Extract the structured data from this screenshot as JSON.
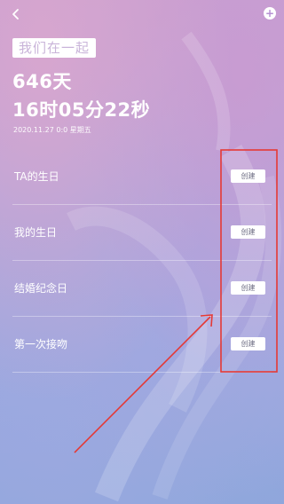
{
  "header": {
    "back_icon": "chevron-left-icon",
    "add_icon": "plus-circle-icon"
  },
  "anniversary": {
    "title": "我们在一起",
    "days": "646天",
    "time": "16时05分22秒",
    "date": "2020.11.27 0:0 星期五"
  },
  "events": [
    {
      "label": "TA的生日",
      "button": "创建"
    },
    {
      "label": "我的生日",
      "button": "创建"
    },
    {
      "label": "结婚纪念日",
      "button": "创建"
    },
    {
      "label": "第一次接吻",
      "button": "创建"
    }
  ],
  "colors": {
    "annotation": "#e53935",
    "accent": "#b68fd3"
  }
}
